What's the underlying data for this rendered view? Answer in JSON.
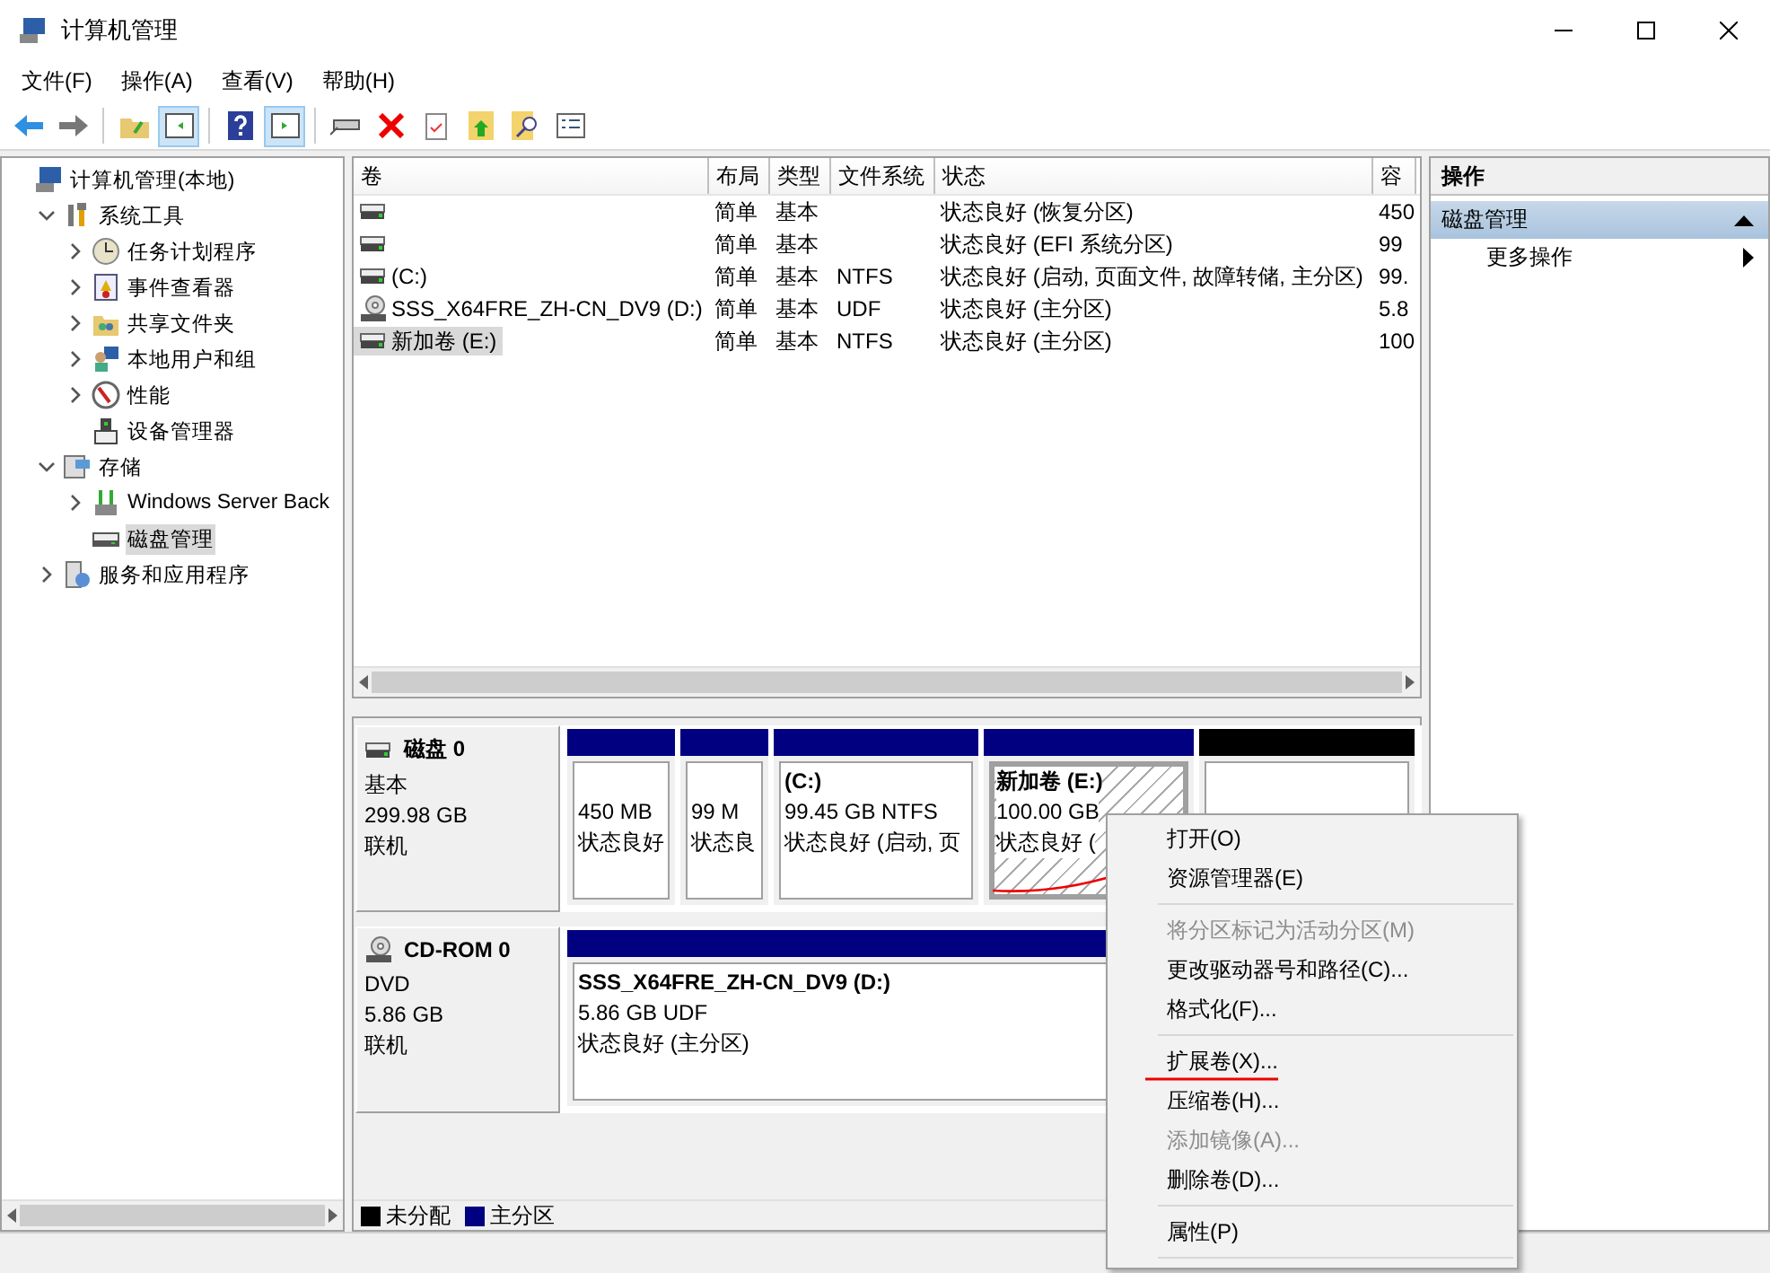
{
  "window": {
    "title": "计算机管理"
  },
  "menu": [
    "文件(F)",
    "操作(A)",
    "查看(V)",
    "帮助(H)"
  ],
  "toolbar": {
    "console_tree_shown": true,
    "action_pane_shown": true
  },
  "tree": [
    {
      "label": "计算机管理(本地)",
      "kind": "computer",
      "selected": false,
      "children": [
        {
          "label": "系统工具",
          "kind": "tools",
          "expandable": true,
          "expanded": true,
          "selected": false,
          "children": [
            {
              "label": "任务计划程序",
              "kind": "clock",
              "expandable": true,
              "expanded": false,
              "selected": false
            },
            {
              "label": "事件查看器",
              "kind": "log",
              "expandable": true,
              "expanded": false,
              "selected": false
            },
            {
              "label": "共享文件夹",
              "kind": "share",
              "expandable": true,
              "expanded": false,
              "selected": false
            },
            {
              "label": "本地用户和组",
              "kind": "users",
              "expandable": true,
              "expanded": false,
              "selected": false
            },
            {
              "label": "性能",
              "kind": "gauge",
              "expandable": true,
              "expanded": false,
              "selected": false
            },
            {
              "label": "设备管理器",
              "kind": "device",
              "expandable": false,
              "expanded": false,
              "selected": false
            }
          ]
        },
        {
          "label": "存储",
          "kind": "storage",
          "expandable": true,
          "expanded": true,
          "selected": false,
          "children": [
            {
              "label": "Windows Server Back",
              "kind": "backup",
              "expandable": true,
              "expanded": false,
              "selected": false
            },
            {
              "label": "磁盘管理",
              "kind": "disk",
              "expandable": false,
              "expanded": false,
              "selected": true
            }
          ]
        },
        {
          "label": "服务和应用程序",
          "kind": "services",
          "expandable": true,
          "expanded": false,
          "selected": false
        }
      ]
    }
  ],
  "volume_list": {
    "columns": [
      "卷",
      "布局",
      "类型",
      "文件系统",
      "状态",
      "容"
    ],
    "rows": [
      {
        "kind": "disk",
        "selected": false,
        "cells": [
          "",
          "简单",
          "基本",
          "",
          "状态良好 (恢复分区)",
          "450"
        ]
      },
      {
        "kind": "disk",
        "selected": false,
        "cells": [
          "",
          "简单",
          "基本",
          "",
          "状态良好 (EFI 系统分区)",
          "99"
        ]
      },
      {
        "kind": "disk",
        "selected": false,
        "cells": [
          "(C:)",
          "简单",
          "基本",
          "NTFS",
          "状态良好 (启动, 页面文件, 故障转储, 主分区)",
          "99."
        ]
      },
      {
        "kind": "cd",
        "selected": false,
        "cells": [
          "SSS_X64FRE_ZH-CN_DV9 (D:)",
          "简单",
          "基本",
          "UDF",
          "状态良好 (主分区)",
          "5.8"
        ]
      },
      {
        "kind": "disk",
        "selected": true,
        "cells": [
          "新加卷 (E:)",
          "简单",
          "基本",
          "NTFS",
          "状态良好 (主分区)",
          "100"
        ]
      }
    ]
  },
  "disks": [
    {
      "kind": "disk",
      "name": "磁盘 0",
      "type": "基本",
      "size": "299.98 GB",
      "status": "联机",
      "partitions": [
        {
          "kind": "primary",
          "selected": false,
          "underlined": false,
          "size": "450 MB",
          "status": "状态良好"
        },
        {
          "kind": "primary",
          "selected": false,
          "underlined": false,
          "size": "99 M",
          "status": "状态良"
        },
        {
          "kind": "primary",
          "selected": false,
          "underlined": false,
          "name": "(C:)",
          "size": "99.45 GB NTFS",
          "status": "状态良好 (启动, 页"
        },
        {
          "kind": "primary",
          "selected": true,
          "underlined": true,
          "name": "新加卷  (E:)",
          "size": "100.00 GB",
          "status": "状态良好 ("
        },
        {
          "kind": "unallocated",
          "selected": false,
          "underlined": false
        }
      ]
    },
    {
      "kind": "cdrom",
      "name": "CD-ROM 0",
      "type": "DVD",
      "size": "5.86 GB",
      "status": "联机",
      "partitions": [
        {
          "kind": "primary",
          "selected": false,
          "underlined": false,
          "name": "SSS_X64FRE_ZH-CN_DV9  (D:)",
          "size": "5.86 GB UDF",
          "status": "状态良好 (主分区)"
        }
      ]
    }
  ],
  "legend": [
    {
      "label": "未分配",
      "color": "#000000"
    },
    {
      "label": "主分区",
      "color": "#000080"
    }
  ],
  "actions": {
    "header": "操作",
    "items": [
      {
        "kind": "group",
        "label": "磁盘管理",
        "selected": true
      },
      {
        "kind": "item",
        "label": "更多操作",
        "selected": false
      }
    ]
  },
  "context_menu": [
    {
      "kind": "item",
      "label": "打开(O)",
      "disabled": false,
      "underlined": false
    },
    {
      "kind": "item",
      "label": "资源管理器(E)",
      "disabled": false,
      "underlined": false
    },
    {
      "kind": "separator"
    },
    {
      "kind": "item",
      "label": "将分区标记为活动分区(M)",
      "disabled": true,
      "underlined": false
    },
    {
      "kind": "item",
      "label": "更改驱动器号和路径(C)...",
      "disabled": false,
      "underlined": false
    },
    {
      "kind": "item",
      "label": "格式化(F)...",
      "disabled": false,
      "underlined": false
    },
    {
      "kind": "separator"
    },
    {
      "kind": "item",
      "label": "扩展卷(X)...",
      "disabled": false,
      "underlined": true
    },
    {
      "kind": "item",
      "label": "压缩卷(H)...",
      "disabled": false,
      "underlined": false
    },
    {
      "kind": "item",
      "label": "添加镜像(A)...",
      "disabled": true,
      "underlined": false
    },
    {
      "kind": "item",
      "label": "删除卷(D)...",
      "disabled": false,
      "underlined": false
    },
    {
      "kind": "separator"
    },
    {
      "kind": "item",
      "label": "属性(P)",
      "disabled": false,
      "underlined": false
    },
    {
      "kind": "separator"
    }
  ]
}
